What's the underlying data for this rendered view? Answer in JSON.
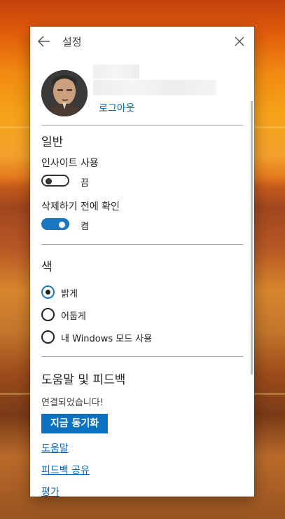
{
  "header": {
    "title": "설정"
  },
  "account": {
    "logout_label": "로그아웃"
  },
  "general": {
    "heading": "일반",
    "insights": {
      "label": "인사이트 사용",
      "state_text": "끔",
      "on": false
    },
    "confirm_delete": {
      "label": "삭제하기 전에 확인",
      "state_text": "켬",
      "on": true
    }
  },
  "color": {
    "heading": "색",
    "options": [
      {
        "label": "밝게",
        "selected": true
      },
      {
        "label": "어둡게",
        "selected": false
      },
      {
        "label": "내 Windows 모드 사용",
        "selected": false
      }
    ]
  },
  "help": {
    "heading": "도움말 및 피드백",
    "status": "연결되었습니다!",
    "sync_button": "지금 동기화",
    "links": [
      "도움말",
      "피드백 공유",
      "평가"
    ]
  },
  "colors": {
    "accent": "#0b72c1",
    "link": "#0a66b8"
  }
}
